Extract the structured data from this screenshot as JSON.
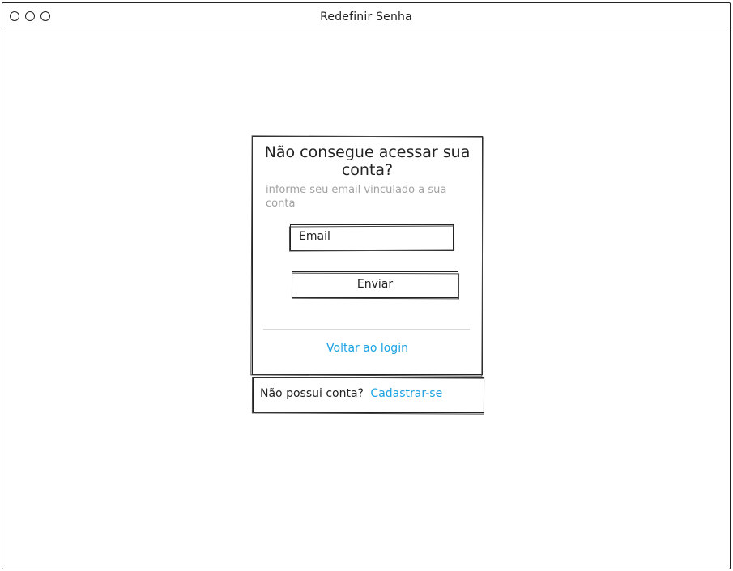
{
  "window": {
    "title": "Redefinir Senha"
  },
  "card": {
    "heading": "Não consegue acessar sua conta?",
    "subtitle": "informe seu email vinculado a sua conta",
    "email_placeholder": "Email",
    "send_label": "Enviar",
    "back_link": "Voltar ao login"
  },
  "signup": {
    "question": "Não possui conta?",
    "link": "Cadastrar-se"
  },
  "colors": {
    "link": "#1ba1e2",
    "muted_text": "#a2a2a2",
    "stroke": "#222222",
    "divider": "#d8d8d8"
  }
}
